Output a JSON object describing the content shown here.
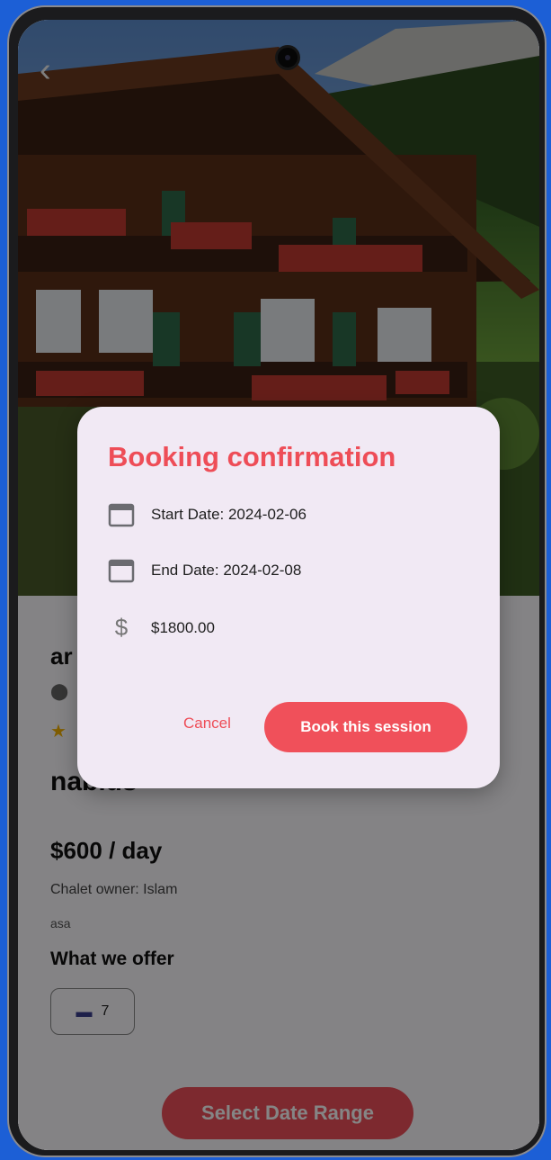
{
  "listing": {
    "title": "ar",
    "city": "nablus",
    "price": "$600 / day",
    "owner": "Chalet owner: Islam",
    "description": "asa",
    "offer_heading": "What we offer",
    "bedrooms": "7",
    "select_date_label": "Select Date Range"
  },
  "dialog": {
    "title": "Booking confirmation",
    "start_date": "Start Date: 2024-02-06",
    "end_date": "End Date: 2024-02-08",
    "total": "$1800.00",
    "cancel_label": "Cancel",
    "book_label": "Book this session"
  },
  "icons": {
    "back": "back-arrow-icon",
    "location": "location-pin-icon",
    "rating": "star-icon",
    "bed": "bed-icon",
    "calendar": "calendar-icon",
    "dollar": "dollar-icon"
  },
  "colors": {
    "accent": "#ee4d57",
    "dialog_bg": "#f1e9f4",
    "device_bg": "#1c5fd6"
  }
}
